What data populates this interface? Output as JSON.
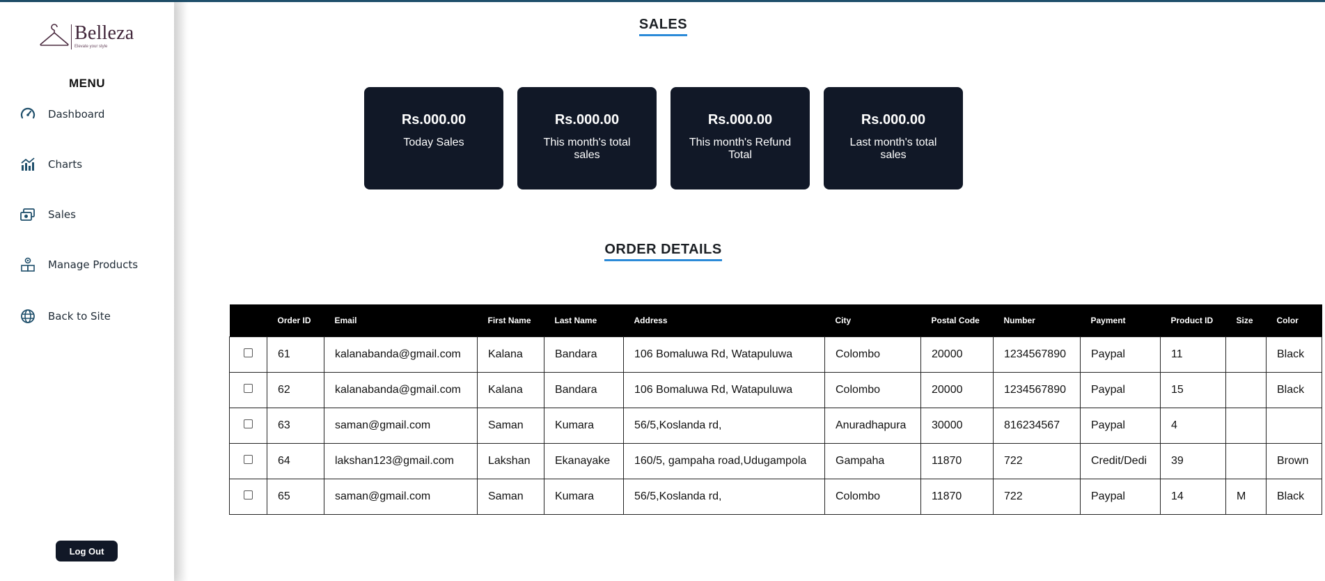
{
  "brand": {
    "name": "Belleza",
    "tagline": "Elevate your style"
  },
  "sidebar": {
    "menu_title": "MENU",
    "items": [
      {
        "label": "Dashboard",
        "icon": "dashboard-gauge-icon"
      },
      {
        "label": "Charts",
        "icon": "chart-icon"
      },
      {
        "label": "Sales",
        "icon": "sales-icon"
      },
      {
        "label": "Manage Products",
        "icon": "manage-products-icon"
      },
      {
        "label": "Back to Site",
        "icon": "globe-icon"
      }
    ],
    "logout_label": "Log Out"
  },
  "sales": {
    "title": "SALES",
    "cards": [
      {
        "amount": "Rs.000.00",
        "label": "Today Sales"
      },
      {
        "amount": "Rs.000.00",
        "label": "This month's total sales"
      },
      {
        "amount": "Rs.000.00",
        "label": "This month's Refund Total"
      },
      {
        "amount": "Rs.000.00",
        "label": "Last month's total sales"
      }
    ]
  },
  "orders": {
    "title": "ORDER DETAILS",
    "columns": [
      "",
      "Order ID",
      "Email",
      "First Name",
      "Last Name",
      "Address",
      "City",
      "Postal Code",
      "Number",
      "Payment",
      "Product ID",
      "Size",
      "Color"
    ],
    "rows": [
      [
        "",
        "61",
        "kalanabanda@gmail.com",
        "Kalana",
        "Bandara",
        "106 Bomaluwa Rd, Watapuluwa",
        "Colombo",
        "20000",
        "1234567890",
        "Paypal",
        "11",
        "",
        "Black"
      ],
      [
        "",
        "62",
        "kalanabanda@gmail.com",
        "Kalana",
        "Bandara",
        "106 Bomaluwa Rd, Watapuluwa",
        "Colombo",
        "20000",
        "1234567890",
        "Paypal",
        "15",
        "",
        "Black"
      ],
      [
        "",
        "63",
        "saman@gmail.com",
        "Saman",
        "Kumara",
        "56/5,Koslanda rd,",
        "Anuradhapura",
        "30000",
        "816234567",
        "Paypal",
        "4",
        "",
        ""
      ],
      [
        "",
        "64",
        "lakshan123@gmail.com",
        "Lakshan",
        "Ekanayake",
        "160/5, gampaha road,Udugampola",
        "Gampaha",
        "11870",
        "722",
        "Credit/Dedi",
        "39",
        "",
        "Brown"
      ],
      [
        "",
        "65",
        "saman@gmail.com",
        "Saman",
        "Kumara",
        "56/5,Koslanda rd,",
        "Colombo",
        "11870",
        "722",
        "Paypal",
        "14",
        "M",
        "Black"
      ]
    ]
  },
  "colors": {
    "dark": "#111827",
    "accent": "#2b8ad8",
    "topline": "#1f4f6b"
  }
}
